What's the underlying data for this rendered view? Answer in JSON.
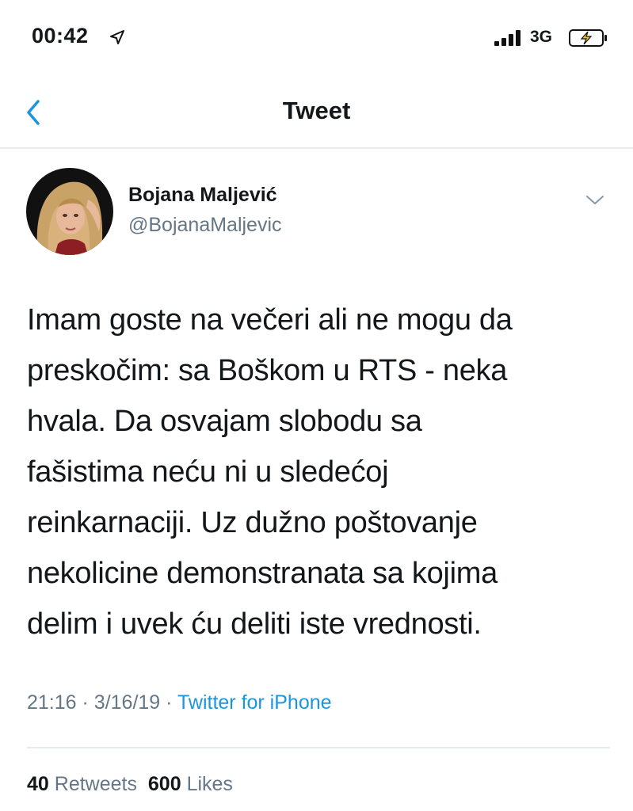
{
  "status_bar": {
    "time": "00:42",
    "network": "3G",
    "icons": [
      "location-arrow-icon",
      "cellular-signal-icon",
      "battery-charging-icon"
    ]
  },
  "nav": {
    "title": "Tweet",
    "back_icon": "chevron-left-icon"
  },
  "tweet": {
    "author": {
      "display_name": "Bojana Maljević",
      "handle": "@BojanaMaljevic"
    },
    "menu_icon": "chevron-down-icon",
    "text_lines": [
      "Imam goste na večeri ali ne mogu da",
      "preskočim: sa Boškom u RTS - neka",
      "hvala. Da osvajam slobodu sa",
      "fašistima neću ni u sledećoj",
      "reinkarnaciji. Uz dužno poštovanje",
      "nekolicine demonstranata sa kojima",
      "delim i uvek ću deliti iste vrednosti."
    ],
    "time": "21:16",
    "date": "3/16/19",
    "separator": "·",
    "source": "Twitter for iPhone",
    "retweets": {
      "count": "40",
      "label": "Retweets"
    },
    "likes": {
      "count": "600",
      "label": "Likes"
    }
  },
  "colors": {
    "accent": "#1b95e0",
    "secondary_text": "#657786",
    "primary_text": "#14171a",
    "divider": "#e6ecf0"
  }
}
